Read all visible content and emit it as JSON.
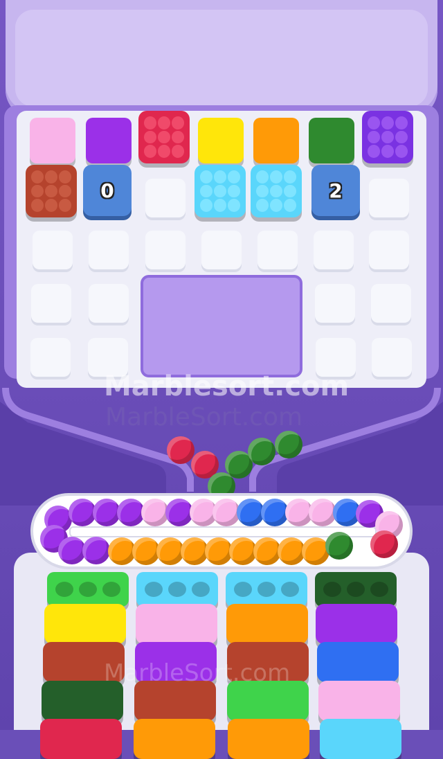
{
  "watermarks": {
    "primary": "Marblesort.com",
    "secondary": "MarbleSort.com",
    "tertiary": "MarbleSort.com"
  },
  "board": {
    "counters": [
      {
        "value": "0"
      },
      {
        "value": "2"
      }
    ]
  },
  "colors": {
    "pink": "#f9b3e8",
    "purple": "#9b30e8",
    "red": "#e0274e",
    "yellow": "#ffe60a",
    "orange": "#ff9a07",
    "green": "#2f8a2f",
    "brown": "#b5432d",
    "cyan": "#5ad6fb",
    "blue": "#2f6ff2",
    "lime": "#3fd34b",
    "darkgreen": "#245f2a",
    "violet": "#7a32e2"
  }
}
